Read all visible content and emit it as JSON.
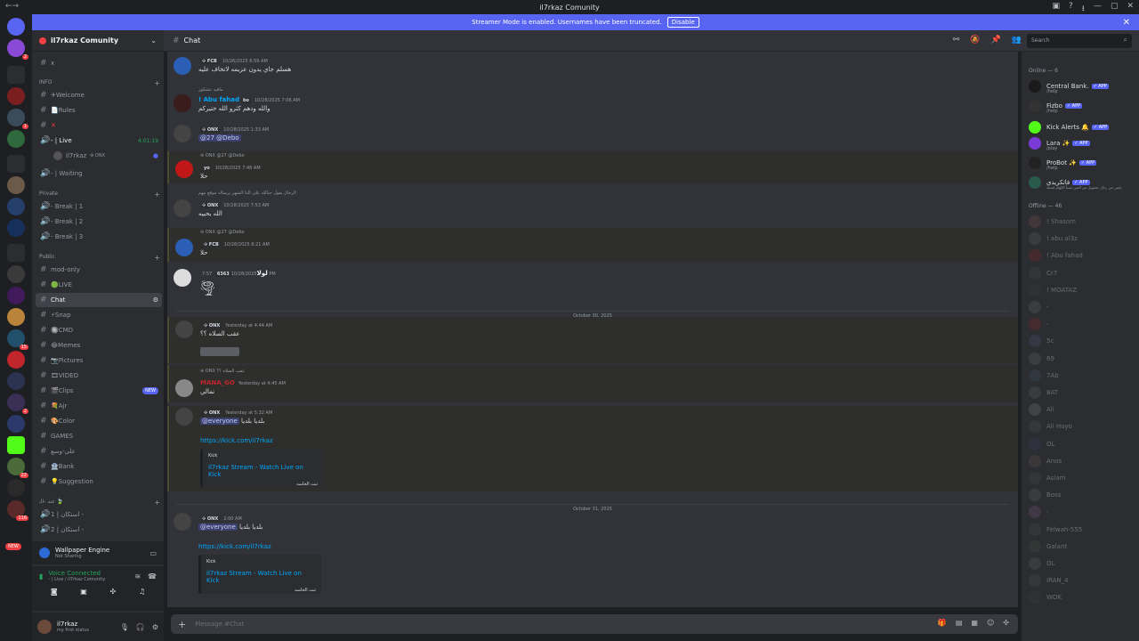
{
  "window": {
    "title": "il7rkaz Comunity",
    "left_icon": "←→",
    "controls": [
      "▣",
      "?",
      "⭳",
      "—",
      "▢",
      "✕"
    ]
  },
  "banner": {
    "text": "Streamer Mode is enabled. Usernames have been truncated.",
    "button": "Disable",
    "close": "✕"
  },
  "server": {
    "name": "il7rkaz Comunity",
    "chevron": "⌄"
  },
  "channels": {
    "top": {
      "name": "x"
    },
    "info_label": "INFO",
    "welcome": "✈Welcome",
    "rules": "📄Rules",
    "x2": "✕",
    "live": "- | Live",
    "live_time": "4:01:19",
    "voice_user": "il7rkaz",
    "voice_user_tag": "✣ ONX",
    "waiting": "- | Waiting",
    "private_label": "Private",
    "break1": "- Break | 1",
    "break2": "- Break | 2",
    "break3": "- Break | 3",
    "public_label": "Public",
    "modonly": "mod-only",
    "live2": "🟢LIVE",
    "chat": "Chat",
    "snap": "⚡Snap",
    "cmd": "🔘CMD",
    "memes": "😂Memes",
    "pictures": "📷Pictures",
    "video": "🎞VIDEO",
    "clips": "🎬Clips",
    "clips_new": "NEW",
    "ajr": "💐Ajr",
    "color": "🎨Color",
    "games": "GAMES",
    "arabic1": "على-وسع",
    "bank": "🏦Bank",
    "suggestion": "💡Suggestion",
    "cat4_label": "عند -الـ 🍃",
    "v1": "استكان | 1 -",
    "v2": "استكان | 2 -"
  },
  "wallpaper": {
    "title": "Wallpaper Engine",
    "sub": "Not Sharing"
  },
  "voice": {
    "status": "Voice Connected",
    "sub": "- | Live / il7rkaz Comunity"
  },
  "user": {
    "name": "il7rkaz",
    "status": "my first status"
  },
  "header": {
    "channel": "Chat",
    "search_placeholder": "Search"
  },
  "messages": [
    {
      "reply": "",
      "name": "",
      "tag": "✣ FCB",
      "time": "10/26/2025 6:59 AM",
      "text": "هسلم جاي يدون عزيمه لاتخاف عليه"
    },
    {
      "reply": "ماقيه عشكور",
      "name": "! Abu fahad",
      "tag": "bo",
      "time": "10/28/2025 7:06 AM",
      "text": "والله ودهم كثرو الله ختيركم"
    },
    {
      "reply": "",
      "name": "",
      "tag": "✣ ONX",
      "time": "10/28/2025 1:33 AM",
      "text": "@27 @Debo"
    },
    {
      "reply": "✣ ONX @27 @Debo",
      "name": "",
      "tag": "yo",
      "time": "10/28/2025 7:48 AM",
      "text": "حلا"
    },
    {
      "reply": "الرجال يقول حيالله علي الذا الشهر برسالة موقع بتهم",
      "name": "",
      "tag": "✣ ONX",
      "time": "10/28/2025 7:53 AM",
      "text": "الله يحييه"
    },
    {
      "reply": "✣ ONX @27 @Debo",
      "name": "",
      "tag": "✣ FCB",
      "time": "10/28/2025 8:21 AM",
      "text": "حلا"
    },
    {
      "reply": "",
      "name": "لولا",
      "tag": "6363",
      "time": "10/28/2025 7:57 PM",
      "text": ""
    },
    {
      "reply": "",
      "name": "",
      "tag": "✣ ONX",
      "time": "Yesterday at 4:44 AM",
      "text": "عقب الصلاه ؟؟"
    },
    {
      "reply": "✣ ONX  عقب الصلاه ؟؟",
      "name": "MANA_GO",
      "tag": "",
      "time": "Yesterday at 4:45 AM",
      "text": "تمالي"
    },
    {
      "reply": "",
      "name": "",
      "tag": "✣ ONX",
      "time": "Yesterday at 5:32 AM",
      "text": "بلديا بلديا",
      "mention": "@everyone",
      "link": "https://kick.com/il7rkaz",
      "embed_provider": "Kick",
      "embed_title": "il7rkaz Stream - Watch Live on Kick",
      "embed_desc": "ثبث الخاسه"
    },
    {
      "reply": "",
      "name": "",
      "tag": "✣ ONX",
      "time": "2:00 AM",
      "text": "بلديا بلديا",
      "mention": "@everyone",
      "link": "https://kick.com/il7rkaz",
      "embed_provider": "Kick",
      "embed_title": "il7rkaz Stream - Watch Live on Kick",
      "embed_desc": "ثبث الخاسه"
    }
  ],
  "dividers": [
    "October 30, 2025",
    "October 31, 2025"
  ],
  "composer": {
    "placeholder": "Message #Chat"
  },
  "members": {
    "online_label": "Online — 6",
    "offline_label": "Offline — 46",
    "online": [
      {
        "name": "Central Bank.",
        "sub": "/help",
        "color": "#f2f3f5"
      },
      {
        "name": "Fizbo",
        "sub": "/help",
        "color": "#f2f3f5"
      },
      {
        "name": "Kick Alerts 🔔",
        "sub": "",
        "color": "#f2f3f5"
      },
      {
        "name": "Lara ✨",
        "sub": "/play",
        "color": "#f2f3f5"
      },
      {
        "name": "ProBot ✨",
        "sub": "/help",
        "color": "#f2f3f5"
      },
      {
        "name": "فاتكريدي",
        "sub": "بإتص عن ردإل ،متعويل من العين بسبأ الإلهام لسمه",
        "color": "#f2f3f5"
      }
    ],
    "offline": [
      {
        "name": "! Shasom"
      },
      {
        "name": "! abu al3z"
      },
      {
        "name": "! Abu fahad"
      },
      {
        "name": "Cr7"
      },
      {
        "name": "! MOATAZ"
      },
      {
        "name": "-"
      },
      {
        "name": "-"
      },
      {
        "name": "5c"
      },
      {
        "name": "69"
      },
      {
        "name": "7Ab"
      },
      {
        "name": "8AT"
      },
      {
        "name": "Ali"
      },
      {
        "name": "Ali Hayo"
      },
      {
        "name": "OL"
      },
      {
        "name": "Anos"
      },
      {
        "name": "Aslam"
      },
      {
        "name": "Boss"
      },
      {
        "name": "-"
      },
      {
        "name": "Felwah-555"
      },
      {
        "name": "Galant"
      },
      {
        "name": "OL"
      },
      {
        "name": "IRAN_4"
      },
      {
        "name": "WOK"
      }
    ]
  },
  "colors": {
    "accent": "#5865f2",
    "live_green": "#23a55a",
    "mention_bg": "#3c4270",
    "link": "#00a8fc",
    "danger": "#f23f43"
  }
}
